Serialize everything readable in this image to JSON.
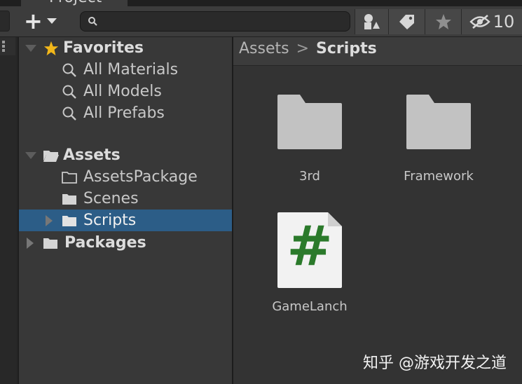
{
  "window": {
    "tab_title": "Project"
  },
  "toolbar": {
    "add_label": "+",
    "search_value": "",
    "hidden_count": "10"
  },
  "tree": {
    "favorites": {
      "label": "Favorites",
      "items": [
        {
          "label": "All Materials"
        },
        {
          "label": "All Models"
        },
        {
          "label": "All Prefabs"
        }
      ]
    },
    "assets": {
      "label": "Assets",
      "children": [
        {
          "label": "AssetsPackage"
        },
        {
          "label": "Scenes"
        },
        {
          "label": "Scripts"
        }
      ]
    },
    "packages": {
      "label": "Packages"
    }
  },
  "breadcrumb": {
    "root": "Assets",
    "separator": ">",
    "current": "Scripts"
  },
  "content": {
    "items": [
      {
        "name": "3rd",
        "type": "folder"
      },
      {
        "name": "Framework",
        "type": "folder"
      },
      {
        "name": "GameLanch",
        "type": "csharp-script",
        "glyph": "#"
      }
    ]
  },
  "watermark": "知乎 @游戏开发之道",
  "colors": {
    "selection": "#2c5d87",
    "folder_icon": "#c2c2c2",
    "script_hash": "#2b7a2b",
    "star": "#f2b71a"
  }
}
